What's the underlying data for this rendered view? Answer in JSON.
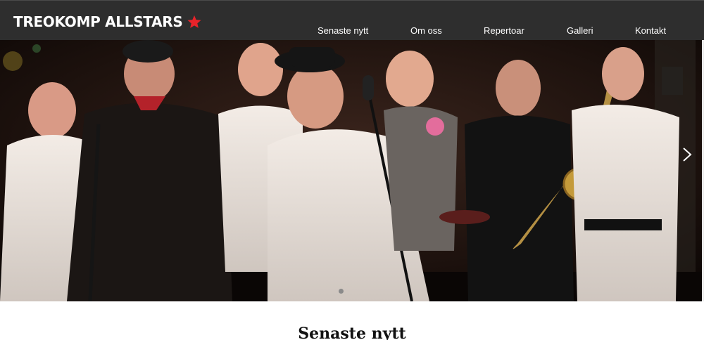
{
  "brand": {
    "name": "TREOKOMP ALLSTARS",
    "star_color": "#e8232a"
  },
  "nav": {
    "items": [
      {
        "label": "Senaste nytt"
      },
      {
        "label": "Om oss"
      },
      {
        "label": "Repertoar"
      },
      {
        "label": "Galleri"
      },
      {
        "label": "Kontakt"
      }
    ]
  },
  "hero": {
    "image": "band-photo",
    "next_icon": "chevron-right-icon",
    "slides_shown": 1,
    "active_slide": 1
  },
  "main": {
    "section_title": "Senaste nytt"
  },
  "colors": {
    "header_bg": "#2e2e2e",
    "text_light": "#ffffff",
    "accent": "#e8232a"
  }
}
